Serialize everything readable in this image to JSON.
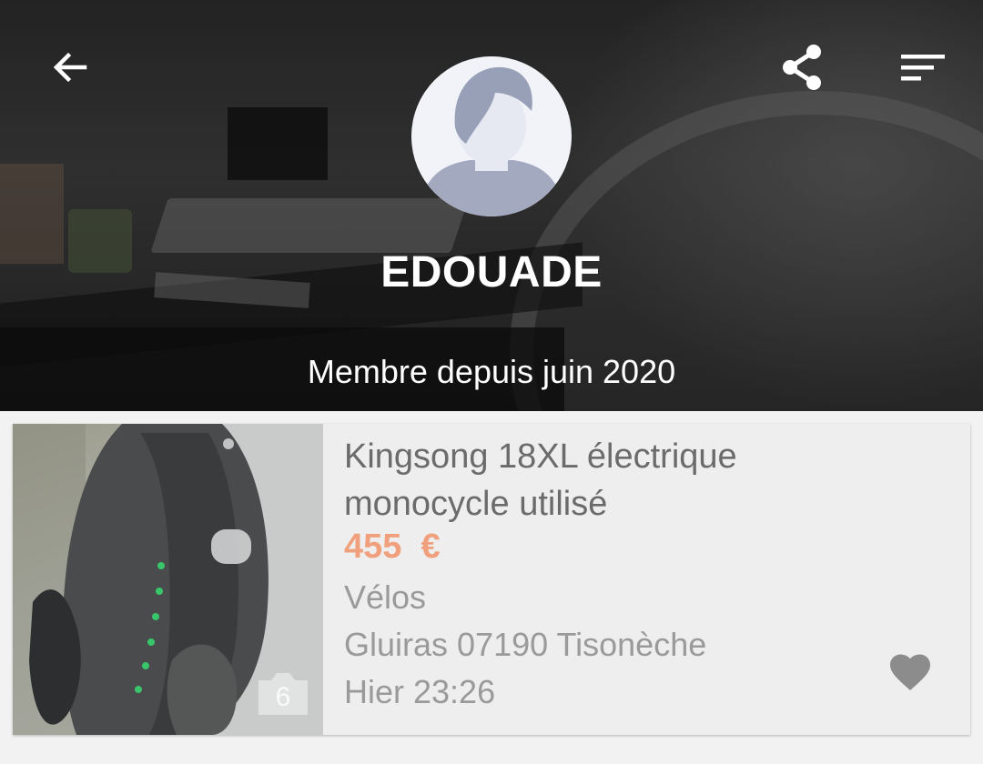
{
  "header": {
    "user_name": "EDOUADE",
    "member_since": "Membre depuis juin 2020"
  },
  "icons": {
    "back": "arrow-left-icon",
    "share": "share-icon",
    "sort": "sort-icon",
    "favorite": "heart-icon",
    "photo_count": "camera-icon",
    "avatar": "user-avatar-icon"
  },
  "listing": {
    "title": "Kingsong 18XL électrique monocycle utilisé",
    "price": "455  €",
    "category": "Vélos",
    "location": "Gluiras 07190 Tisonèche",
    "date": "Hier 23:26",
    "photo_count": "6"
  },
  "colors": {
    "price": "#f0a07c",
    "text_secondary": "#9a9a9a",
    "title": "#6b6b6b",
    "card_bg": "#eeeeee",
    "page_bg": "#f2f2f2",
    "heart": "#8c8c8c"
  }
}
